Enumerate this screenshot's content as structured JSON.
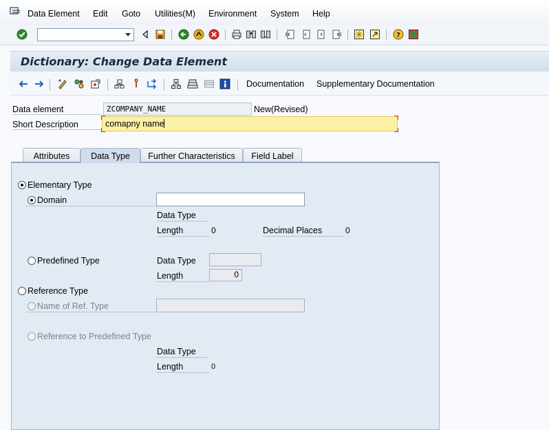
{
  "menu": {
    "items": [
      "Data Element",
      "Edit",
      "Goto",
      "Utilities(M)",
      "Environment",
      "System",
      "Help"
    ]
  },
  "command_field": {
    "value": ""
  },
  "title": "Dictionary: Change Data Element",
  "app_toolbar": {
    "documentation": "Documentation",
    "supplementary_documentation": "Supplementary Documentation"
  },
  "header": {
    "data_element_label": "Data element",
    "data_element_value": "ZCOMPANY_NAME",
    "status": "New(Revised)",
    "short_description_label": "Short Description",
    "short_description_value": "comapny name"
  },
  "tabs": [
    "Attributes",
    "Data Type",
    "Further Characteristics",
    "Field Label"
  ],
  "active_tab": "Data Type",
  "data_type_tab": {
    "elementary_type": "Elementary Type",
    "domain": "Domain",
    "domain_value": "",
    "domain_data_type_label": "Data Type",
    "domain_length_label": "Length",
    "domain_length_value": "0",
    "decimal_places_label": "Decimal Places",
    "decimal_places_value": "0",
    "predefined_type": "Predefined Type",
    "predef_data_type_label": "Data Type",
    "predef_data_type_value": "",
    "predef_length_label": "Length",
    "predef_length_value": "0",
    "reference_type": "Reference Type",
    "name_of_ref_type": "Name of Ref. Type",
    "name_of_ref_type_value": "",
    "reference_to_predefined_type": "Reference to Predefined Type",
    "ref_data_type_label": "Data Type",
    "ref_length_label": "Length",
    "ref_length_value": "0"
  },
  "colors": {
    "accent": "#8fa5c0",
    "required_field": "#fbf1a6",
    "panel": "#e2eaf4"
  }
}
